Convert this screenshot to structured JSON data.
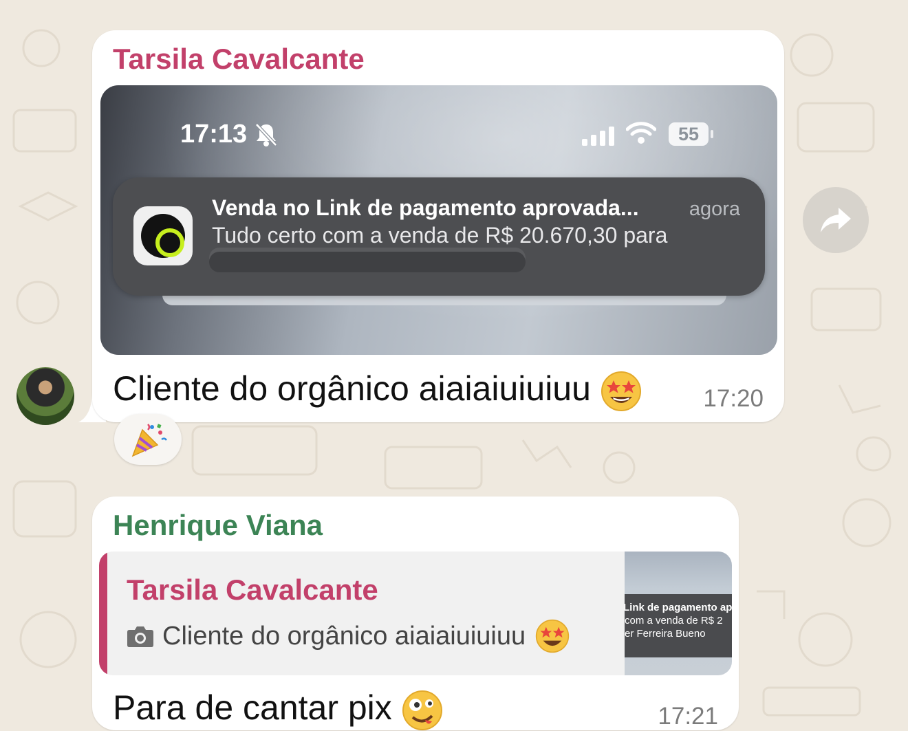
{
  "messages": [
    {
      "sender": "Tarsila Cavalcante",
      "sender_color": "#c2406a",
      "screenshot": {
        "status_time": "17:13",
        "battery": "55",
        "notification": {
          "title": "Venda no Link de pagamento aprovada...",
          "time": "agora",
          "body": "Tudo certo com a venda de R$ 20.670,30 para"
        }
      },
      "caption": "Cliente do orgânico aiaiaiuiuiuu",
      "caption_emoji": "star-struck-emoji",
      "time": "17:20",
      "reaction": "party-popper-emoji"
    },
    {
      "sender": "Henrique Viana",
      "sender_color": "#3c8455",
      "quote": {
        "sender": "Tarsila Cavalcante",
        "text": "Cliente do orgânico aiaiaiuiuiuu",
        "thumb_lines": [
          "Link de pagamento ap",
          "com a venda de R$ 2",
          "er Ferreira Bueno"
        ]
      },
      "caption": "Para de cantar pix",
      "caption_emoji": "zany-face-emoji",
      "time": "17:21"
    }
  ],
  "icons": {
    "forward": "forward-arrow-icon",
    "camera": "camera-icon",
    "bell": "bell-slash-icon",
    "wifi": "wifi-icon",
    "signal": "signal-icon"
  }
}
